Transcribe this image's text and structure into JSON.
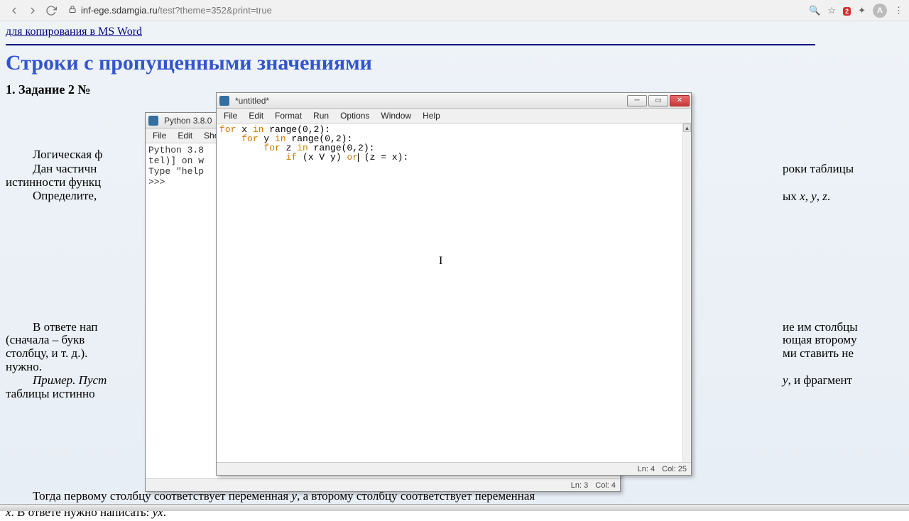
{
  "browser": {
    "url_domain": "inf-ege.sdamgia.ru",
    "url_path": "/test?theme=352&print=true",
    "badge": "2",
    "avatar_letter": "A"
  },
  "page": {
    "top_link": "для копирования в MS Word",
    "section_title": "Строки с пропущенными значениями",
    "task_title": "1. Задание 2 №",
    "left": {
      "l1": "Логическая ф",
      "l2": "Дан  частичн",
      "l3": "истинности функц",
      "l4": "Определите,",
      "l5": "В ответе нап",
      "l6": "(сначала – букв",
      "l7": "столбцу, и т. д.).",
      "l8": "нужно.",
      "l9": "Пример.  Пуст",
      "l10": "таблицы истинно"
    },
    "right": {
      "r1": "роки  таблицы",
      "r2": "ых x, y, z.",
      "r3": "ие им столбцы",
      "r4": "ющая второму",
      "r5": "ми ставить не",
      "r6": "",
      "r7": ", и фрагмент",
      "r8": ""
    },
    "bottom1": "Тогда первому столбцу соответствует переменная y, а второму столбцу соответствует переменная",
    "bottom2": "x. В ответе нужно написать: yx."
  },
  "shell": {
    "title": "Python 3.8.0",
    "menus": [
      "File",
      "Edit",
      "She"
    ],
    "line1": "Python 3.8",
    "line2": "tel)] on w",
    "line3": "Type \"help",
    "prompt": ">>>",
    "status_ln": "Ln: 3",
    "status_col": "Col: 4"
  },
  "editor_win": {
    "title": "*untitled*",
    "menus": [
      "File",
      "Edit",
      "Format",
      "Run",
      "Options",
      "Window",
      "Help"
    ],
    "code": {
      "l1a": "for",
      "l1b": " x ",
      "l1c": "in",
      "l1d": " range(0,2):",
      "l2a": "    for",
      "l2b": " y ",
      "l2c": "in",
      "l2d": " range(0,2):",
      "l3a": "        for",
      "l3b": " z ",
      "l3c": "in",
      "l3d": " range(0,2):",
      "l4a": "            if",
      "l4b": " (x V y) ",
      "l4c": "or",
      "l4d": " (z = x):"
    },
    "status_ln": "Ln: 4",
    "status_col": "Col: 25"
  }
}
